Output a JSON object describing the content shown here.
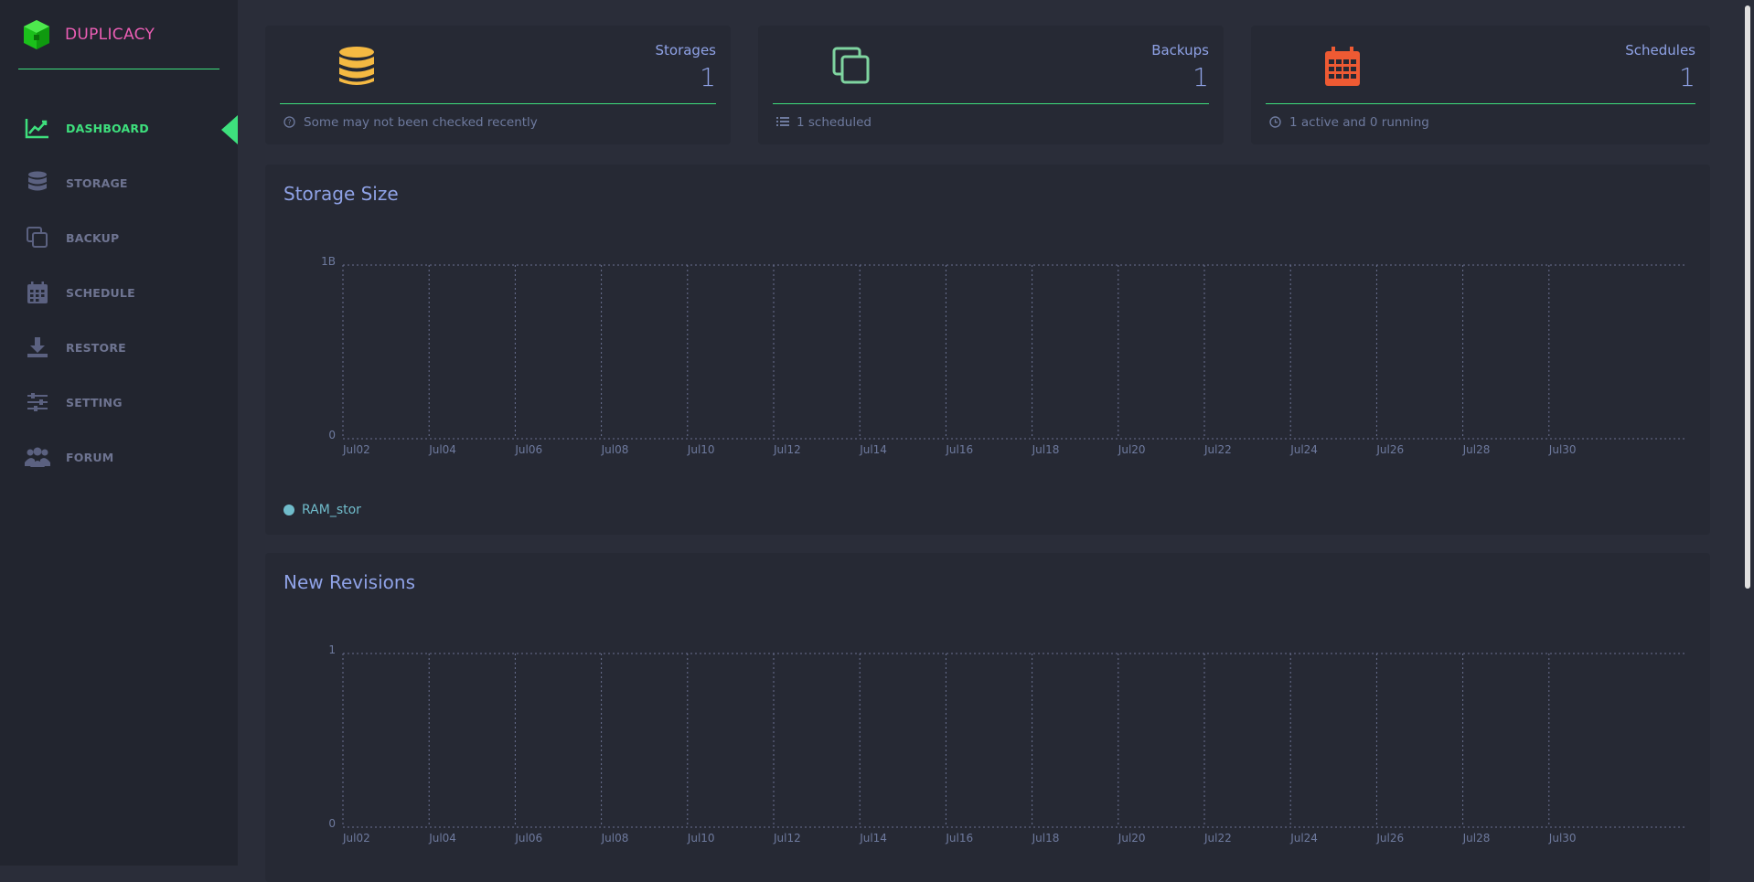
{
  "brand": {
    "name": "DUPLICACY"
  },
  "nav": {
    "items": [
      {
        "label": "DASHBOARD",
        "icon": "chart-line-icon",
        "active": true
      },
      {
        "label": "STORAGE",
        "icon": "database-icon"
      },
      {
        "label": "BACKUP",
        "icon": "copy-icon"
      },
      {
        "label": "SCHEDULE",
        "icon": "calendar-icon"
      },
      {
        "label": "RESTORE",
        "icon": "download-icon"
      },
      {
        "label": "SETTING",
        "icon": "sliders-icon"
      },
      {
        "label": "FORUM",
        "icon": "users-icon"
      }
    ]
  },
  "stats": {
    "storages": {
      "title": "Storages",
      "value": "1",
      "foot": "Some may not been checked recently",
      "icon": "database-icon",
      "color": "#f5b942"
    },
    "backups": {
      "title": "Backups",
      "value": "1",
      "foot": "1 scheduled",
      "icon": "copy-icon",
      "color": "#7fd4a0"
    },
    "schedules": {
      "title": "Schedules",
      "value": "1",
      "foot": "1 active and 0 running",
      "icon": "calendar-icon",
      "color": "#ee5a33"
    }
  },
  "colors": {
    "accent": "#3ee07d",
    "brand": "#ec5eb5",
    "text": "#8fa2e6",
    "series": "#70bccb"
  },
  "chart_data": [
    {
      "type": "line",
      "title": "Storage Size",
      "x": [
        "Jul02",
        "Jul04",
        "Jul06",
        "Jul08",
        "Jul10",
        "Jul12",
        "Jul14",
        "Jul16",
        "Jul18",
        "Jul20",
        "Jul22",
        "Jul24",
        "Jul26",
        "Jul28",
        "Jul30"
      ],
      "yticks": [
        "0",
        "1B"
      ],
      "ylim": [
        0,
        1
      ],
      "grid": true,
      "series": [
        {
          "name": "RAM_stor",
          "values": []
        }
      ],
      "legend": "bottom-left"
    },
    {
      "type": "line",
      "title": "New Revisions",
      "x": [
        "Jul02",
        "Jul04",
        "Jul06",
        "Jul08",
        "Jul10",
        "Jul12",
        "Jul14",
        "Jul16",
        "Jul18",
        "Jul20",
        "Jul22",
        "Jul24",
        "Jul26",
        "Jul28",
        "Jul30"
      ],
      "yticks": [
        "0",
        "1"
      ],
      "ylim": [
        0,
        1
      ],
      "grid": true,
      "series": []
    }
  ]
}
